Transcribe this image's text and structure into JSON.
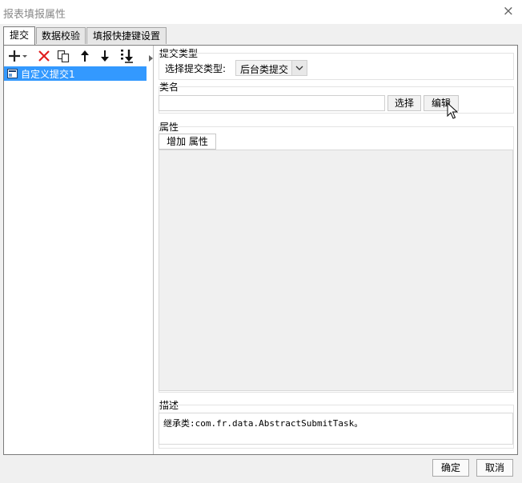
{
  "window": {
    "title": "报表填报属性",
    "close_glyph": "×"
  },
  "tabs": [
    {
      "label": "提交",
      "active": true
    },
    {
      "label": "数据校验",
      "active": false
    },
    {
      "label": "填报快捷键设置",
      "active": false
    }
  ],
  "toolbar": {
    "icons": [
      "add-icon",
      "delete-icon",
      "copy-icon",
      "move-up-icon",
      "move-down-icon",
      "move-bottom-icon"
    ],
    "add_color": "#222222",
    "delete_color": "#e02020"
  },
  "submit_list": {
    "items": [
      {
        "label": "自定义提交1",
        "selected": true
      }
    ],
    "selected_color": "#3399ff"
  },
  "submit_type": {
    "section_label": "提交类型",
    "select_label": "选择提交类型:",
    "selected_value": "后台类提交"
  },
  "class_name": {
    "section_label": "类名",
    "value": "",
    "choose_button": "选择",
    "edit_button": "编辑"
  },
  "properties": {
    "section_label": "属性",
    "add_button": "增加 属性"
  },
  "description": {
    "section_label": "描述",
    "text": "继承类:com.fr.data.AbstractSubmitTask。"
  },
  "footer": {
    "ok_button": "确定",
    "cancel_button": "取消"
  }
}
